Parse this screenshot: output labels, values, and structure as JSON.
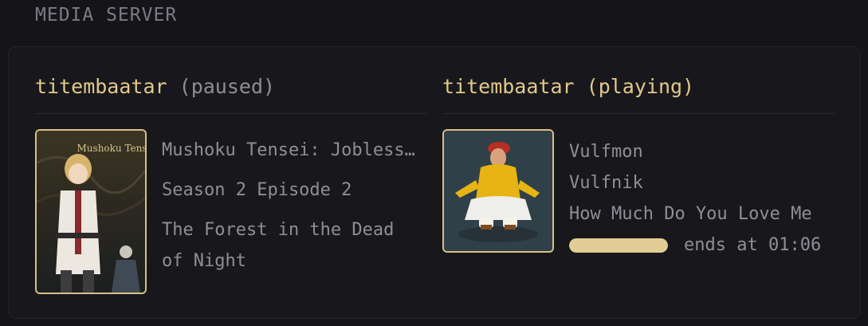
{
  "section": {
    "title": "MEDIA SERVER"
  },
  "sessions": [
    {
      "user": "titembaatar",
      "state": "(paused)",
      "poster_logo": "Mushoku Tensei",
      "title": "Mushoku Tensei: Jobless Reincarnation",
      "subtitle": "Season 2 Episode 2",
      "episode": "The Forest in the Dead of Night"
    },
    {
      "user": "titembaatar",
      "state": "(playing)",
      "artist": "Vulfmon",
      "album": "Vulfnik",
      "track": "How Much Do You Love Me",
      "progress": 1.0,
      "ends_text": "ends at 01:06"
    }
  ],
  "colors": {
    "accent": "#e2c98b",
    "muted": "#8e8e96",
    "background": "#151519",
    "panel": "#18181c"
  }
}
